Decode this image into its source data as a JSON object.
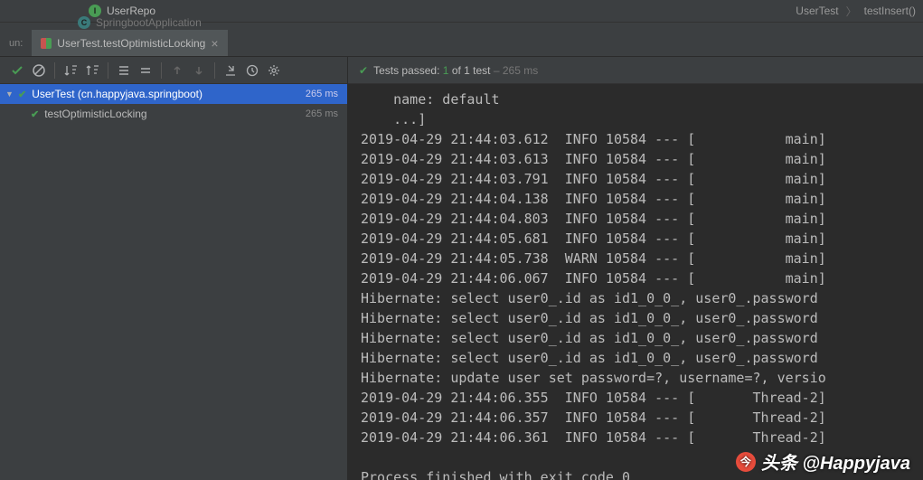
{
  "project_tree": {
    "item1": {
      "icon": "I",
      "label": "UserRepo"
    },
    "item2": {
      "icon": "C",
      "label": "SpringbootApplication"
    }
  },
  "breadcrumb": {
    "parent": "UserTest",
    "method": "testInsert()"
  },
  "tab": {
    "label": "UserTest.testOptimisticLocking"
  },
  "run_label": "un:",
  "status": {
    "prefix": "Tests passed:",
    "count": "1",
    "middle": "of 1 test",
    "duration": "– 265 ms"
  },
  "tree": {
    "root": {
      "label": "UserTest (cn.happyjava.springboot)",
      "time": "265 ms"
    },
    "child": {
      "label": "testOptimisticLocking",
      "time": "265 ms"
    }
  },
  "console_lines": [
    "    name: default",
    "    ...]",
    "2019-04-29 21:44:03.612  INFO 10584 --- [           main]",
    "2019-04-29 21:44:03.613  INFO 10584 --- [           main]",
    "2019-04-29 21:44:03.791  INFO 10584 --- [           main]",
    "2019-04-29 21:44:04.138  INFO 10584 --- [           main]",
    "2019-04-29 21:44:04.803  INFO 10584 --- [           main]",
    "2019-04-29 21:44:05.681  INFO 10584 --- [           main]",
    "2019-04-29 21:44:05.738  WARN 10584 --- [           main]",
    "2019-04-29 21:44:06.067  INFO 10584 --- [           main]",
    "Hibernate: select user0_.id as id1_0_0_, user0_.password ",
    "Hibernate: select user0_.id as id1_0_0_, user0_.password ",
    "Hibernate: select user0_.id as id1_0_0_, user0_.password ",
    "Hibernate: select user0_.id as id1_0_0_, user0_.password ",
    "Hibernate: update user set password=?, username=?, versio",
    "2019-04-29 21:44:06.355  INFO 10584 --- [       Thread-2]",
    "2019-04-29 21:44:06.357  INFO 10584 --- [       Thread-2]",
    "2019-04-29 21:44:06.361  INFO 10584 --- [       Thread-2]",
    "",
    "Process finished with exit code 0"
  ],
  "watermark": {
    "text": "头条 @Happyjava",
    "icon": "今"
  }
}
